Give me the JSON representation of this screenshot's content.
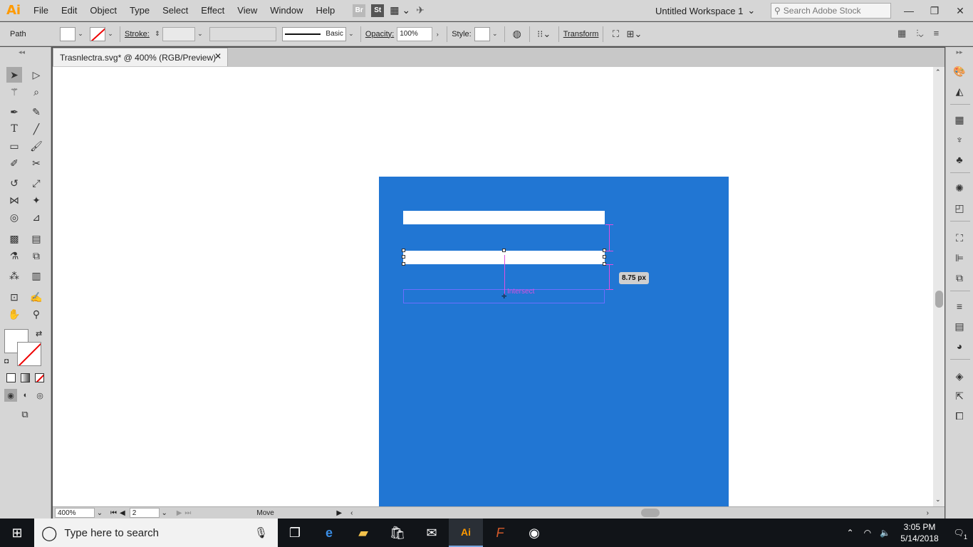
{
  "app": {
    "logo": "Ai",
    "menu": [
      "File",
      "Edit",
      "Object",
      "Type",
      "Select",
      "Effect",
      "View",
      "Window",
      "Help"
    ],
    "bridge_icon": "Br",
    "stock_icon": "St"
  },
  "workspace": {
    "name": "Untitled Workspace 1"
  },
  "stock_search": {
    "placeholder": "Search Adobe Stock"
  },
  "controlbar": {
    "selection_label": "Path",
    "stroke_label": "Stroke:",
    "brush_label": "Basic",
    "opacity_label": "Opacity:",
    "opacity_value": "100%",
    "style_label": "Style:",
    "transform_label": "Transform"
  },
  "document": {
    "tab_title": "Trasnlectra.svg* @ 400% (RGB/Preview)"
  },
  "canvas": {
    "measure_tooltip": "8.75 px",
    "smart_guide_label": "Intersect"
  },
  "status": {
    "zoom": "400%",
    "artboard": "2",
    "tool": "Move"
  },
  "taskbar": {
    "search_placeholder": "Type here to search",
    "time": "3:05 PM",
    "date": "5/14/2018",
    "notifications": "1"
  },
  "colors": {
    "artboard": "#2176d3",
    "smart_guide": "#e04fe0",
    "accent": "#ff9a00"
  }
}
